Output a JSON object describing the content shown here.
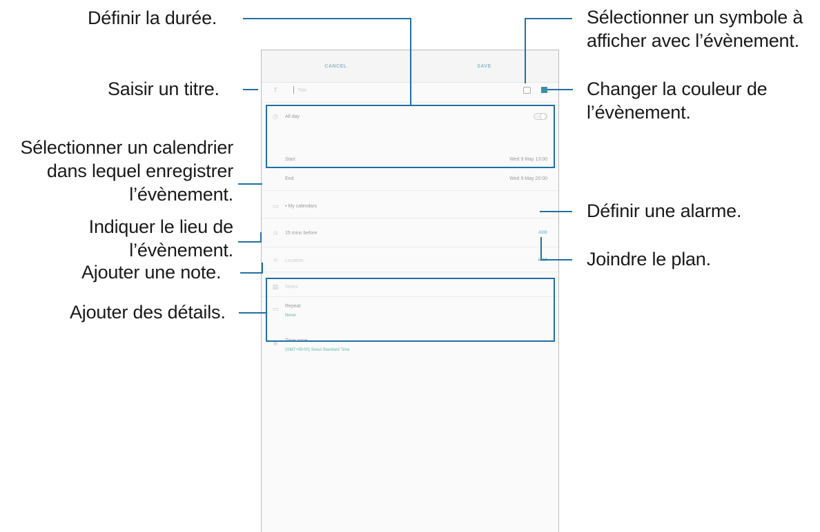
{
  "callouts": {
    "duration": "Définir la durée.",
    "title": "Saisir un titre.",
    "calendar": [
      "Sélectionner un calendrier",
      "dans lequel enregistrer",
      "l’évènement."
    ],
    "location": [
      "Indiquer le lieu de",
      "l’évènement."
    ],
    "note": "Ajouter une note.",
    "details": "Ajouter des détails.",
    "sticker": [
      "Sélectionner un symbole à",
      "afficher avec l’évènement."
    ],
    "color": [
      "Changer la couleur de",
      "l’évènement."
    ],
    "alarm": "Définir une alarme.",
    "map": "Joindre le plan."
  },
  "screen": {
    "topbar": {
      "cancel_label": "CANCEL",
      "save_label": "SAVE"
    },
    "title_placeholder": "Title",
    "all_day_label": "All day",
    "start_label": "Start",
    "start_value": "Wed 9 May   13:00",
    "end_label": "End",
    "end_value": "Wed 9 May   20:00",
    "calendar_value": "• My calendars",
    "reminder_value": "15 mins before",
    "reminder_action": "ADD",
    "location_placeholder": "Location",
    "location_action": "MAP",
    "notes_placeholder": "Notes",
    "repeat_label": "Repeat",
    "repeat_value": "Never",
    "timezone_label": "Time zone",
    "timezone_value": "(GMT+09:00) Seoul Standard Time"
  },
  "colors": {
    "accent_line": "#1f6fa3",
    "event_color": "#3d8fa6",
    "teal_text": "#5fb8aa"
  },
  "icons": [
    "title-icon",
    "clock-icon",
    "calendar-icon",
    "bell-icon",
    "pin-icon",
    "note-icon",
    "repeat-icon",
    "globe-icon",
    "sticker-icon",
    "color-swatch"
  ]
}
